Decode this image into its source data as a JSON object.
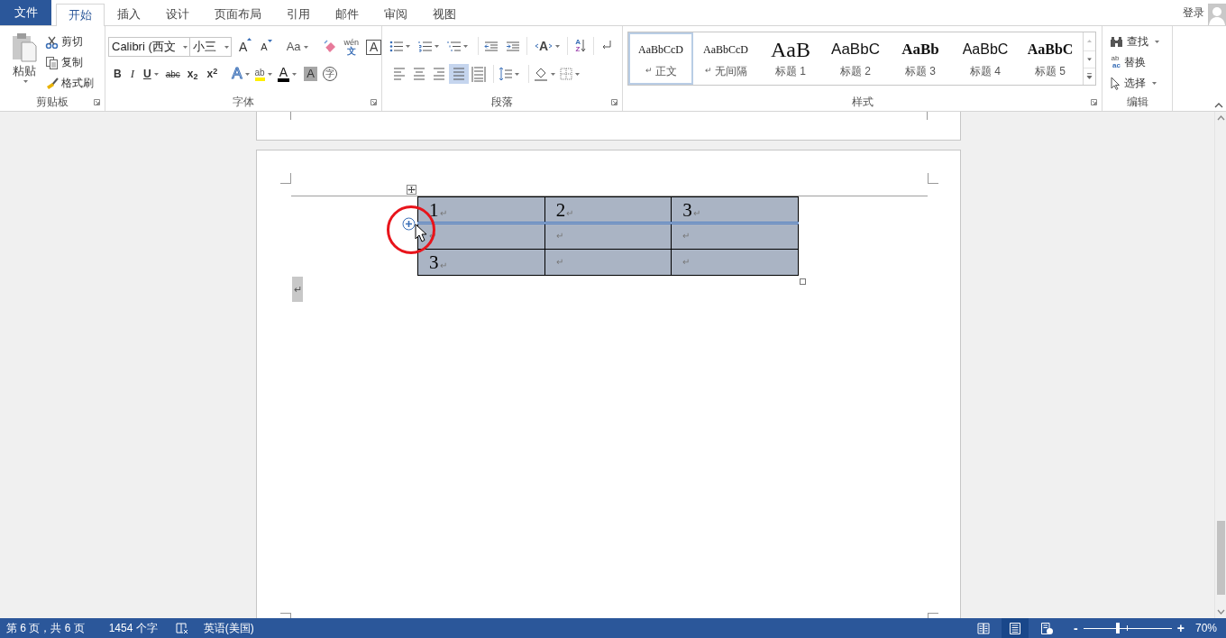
{
  "tabs": {
    "file": "文件",
    "items": [
      {
        "label": "开始",
        "selected": true
      },
      {
        "label": "插入",
        "selected": false
      },
      {
        "label": "设计",
        "selected": false
      },
      {
        "label": "页面布局",
        "selected": false
      },
      {
        "label": "引用",
        "selected": false
      },
      {
        "label": "邮件",
        "selected": false
      },
      {
        "label": "审阅",
        "selected": false
      },
      {
        "label": "视图",
        "selected": false
      }
    ],
    "sign_in": "登录"
  },
  "clipboard": {
    "paste": "粘贴",
    "cut": "剪切",
    "copy": "复制",
    "format_painter": "格式刷",
    "label": "剪贴板"
  },
  "font": {
    "font_name": "Calibri (西文",
    "font_size": "小三",
    "row_1": [
      {
        "kind": "grow",
        "text": "A",
        "dropdown": false
      },
      {
        "kind": "shrink",
        "text": "A",
        "dropdown": false
      },
      {
        "kind": "case",
        "text": "Aa",
        "dropdown": true
      },
      {
        "kind": "clear",
        "dropdown": false
      },
      {
        "kind": "phonetic",
        "text": "wén",
        "sub": "文",
        "dropdown": false
      },
      {
        "kind": "border",
        "text": "A",
        "dropdown": false
      }
    ],
    "row_2": [
      {
        "kind": "bold",
        "text": "B",
        "dropdown": false
      },
      {
        "kind": "italic",
        "text": "I",
        "dropdown": false
      },
      {
        "kind": "underline",
        "text": "U",
        "dropdown": true
      },
      {
        "kind": "strike",
        "text": "abc",
        "dropdown": false
      },
      {
        "kind": "script",
        "text": "x$_{2}$",
        "dropdown": false
      },
      {
        "kind": "script",
        "text": "x$^{2}$",
        "dropdown": false
      },
      {
        "kind": "effects",
        "text": "A",
        "dropdown": true
      },
      {
        "kind": "highlight",
        "text": "ab",
        "dropdown": true
      },
      {
        "kind": "color",
        "text": "A",
        "dropdown": true
      },
      {
        "kind": "shading",
        "text": "A",
        "dropdown": false
      },
      {
        "kind": "enclose",
        "text": "字",
        "dropdown": false
      }
    ],
    "label": "字体"
  },
  "paragraph": {
    "direction_letter": "A",
    "sort_letters": [
      "A",
      "Z"
    ],
    "align": [
      {
        "selected": false
      },
      {
        "selected": false
      },
      {
        "selected": false
      },
      {
        "selected": true
      },
      {
        "selected": false
      }
    ],
    "label": "段落"
  },
  "styles": {
    "items": [
      {
        "kind": "normal",
        "preview": "AaBbCcD",
        "mark": "↵",
        "label": "正文",
        "selected": true
      },
      {
        "kind": "normal",
        "preview": "AaBbCcD",
        "mark": "↵",
        "label": "无间隔",
        "selected": false
      },
      {
        "kind": "h1",
        "preview": "AaB",
        "label": "标题 1",
        "selected": false
      },
      {
        "kind": "h2",
        "preview": "AaBbC",
        "label": "标题 2",
        "selected": false
      },
      {
        "kind": "h3",
        "preview": "AaBb",
        "label": "标题 3",
        "selected": false
      },
      {
        "kind": "h4",
        "preview": "AaBbC",
        "label": "标题 4",
        "selected": false
      },
      {
        "kind": "h5",
        "preview": "AaBbC",
        "label": "标题 5",
        "selected": false
      }
    ],
    "label": "样式"
  },
  "editing": {
    "find": "查找",
    "replace_letters": [
      "ab",
      "ac"
    ],
    "replace": "替换",
    "select": "选择",
    "label": "编辑"
  },
  "document": {
    "table": {
      "rows": [
        [
          {
            "text": "1",
            "mark": "↵"
          },
          {
            "text": "2",
            "mark": "↵"
          },
          {
            "text": "3",
            "mark": "↵"
          }
        ],
        [
          {
            "mark": "↵"
          },
          {
            "mark": "↵"
          },
          {
            "mark": "↵"
          }
        ],
        [
          {
            "text": "3",
            "mark": "↵"
          },
          {
            "mark": "↵"
          },
          {
            "mark": "↵"
          }
        ]
      ]
    },
    "paragraph_mark": "↵"
  },
  "status_bar": {
    "page": "第 6 页，共 6 页",
    "words": "1454 个字",
    "language": "英语(美国)",
    "views": [
      {
        "selected": false
      },
      {
        "selected": true
      },
      {
        "selected": false
      }
    ],
    "zoom_out": "-",
    "zoom": {
      "level": 0.37
    },
    "zoom_in": "+",
    "zoom_percent": "70%"
  }
}
